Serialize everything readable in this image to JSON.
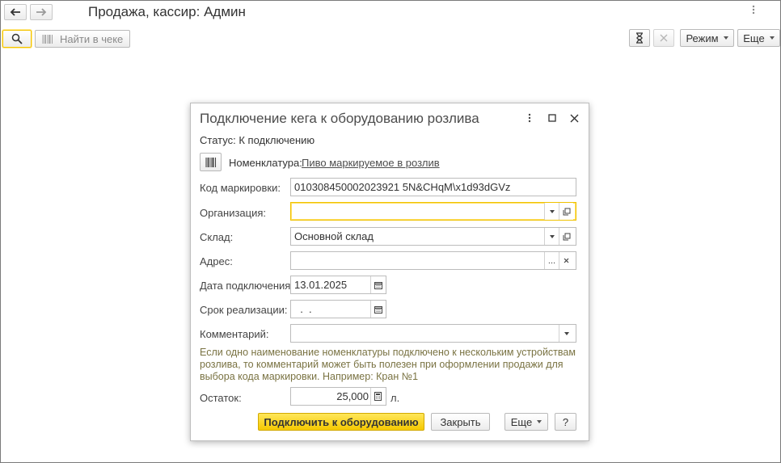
{
  "window": {
    "title": "Продажа, кассир: Админ"
  },
  "toolbar": {
    "find_label": "Найти в чеке",
    "mode_label": "Режим",
    "more_label": "Еще"
  },
  "dialog": {
    "title": "Подключение кега к оборудованию розлива",
    "status_label": "Статус:",
    "status_value": "К подключению",
    "nomenclature_label": "Номенклатура:",
    "nomenclature_value": "Пиво маркируемое в розлив",
    "fields": {
      "marking_code": {
        "label": "Код маркировки:",
        "value": "010308450002023921 5N&CHqM\\x1d93dGVz"
      },
      "organization": {
        "label": "Организация:",
        "value": ""
      },
      "warehouse": {
        "label": "Склад:",
        "value": "Основной склад"
      },
      "address": {
        "label": "Адрес:",
        "value": ""
      },
      "connection_date": {
        "label": "Дата подключения:",
        "value": "13.01.2025"
      },
      "expiry": {
        "label": "Срок реализации:",
        "value": "  .  ."
      },
      "comment": {
        "label": "Комментарий:",
        "value": ""
      },
      "remainder": {
        "label": "Остаток:",
        "value": "25,000",
        "unit": "л."
      }
    },
    "hint": "Если одно наименование номенклатуры подключено к нескольким устройствам розлива, то комментарий может быть полезен при оформлении продажи для выбора кода маркировки. Например: Кран №1",
    "buttons": {
      "connect": "Подключить к оборудованию",
      "close": "Закрыть",
      "more": "Еще",
      "help": "?"
    }
  },
  "colors": {
    "accent_yellow": "#f5c900",
    "focus_border": "#f0c200",
    "hint_text": "#7a7343"
  },
  "icons": [
    "back-arrow-icon",
    "forward-arrow-icon",
    "search-icon",
    "barcode-icon",
    "hourglass-icon",
    "close-icon",
    "more-vertical-icon",
    "maximize-icon",
    "calendar-icon",
    "calculator-icon",
    "open-icon",
    "chevron-down-icon"
  ]
}
